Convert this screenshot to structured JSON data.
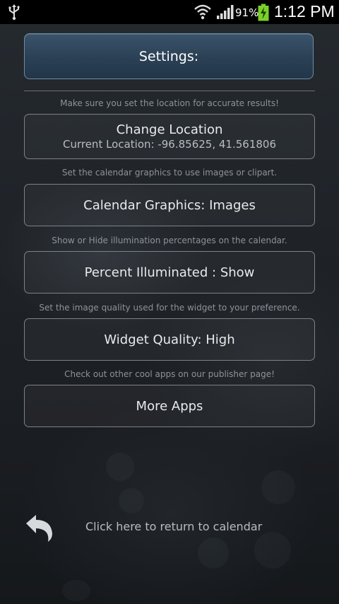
{
  "status_bar": {
    "battery_percent": "91%",
    "time": "1:12 PM",
    "icons": [
      "usb-icon",
      "wifi-icon",
      "signal-icon",
      "battery-charging-icon"
    ]
  },
  "header": {
    "title": "Settings:"
  },
  "sections": [
    {
      "hint": "Make sure you set the location for accurate results!",
      "button_label": "Change Location",
      "button_sub": "Current Location: -96.85625, 41.561806"
    },
    {
      "hint": "Set the calendar graphics to use images or clipart.",
      "button_label": "Calendar Graphics: Images"
    },
    {
      "hint": "Show or Hide illumination percentages on the calendar.",
      "button_label": "Percent Illuminated : Show"
    },
    {
      "hint": "Set the image quality used for the widget to your preference.",
      "button_label": "Widget Quality: High"
    },
    {
      "hint": "Check out other cool apps on our publisher page!",
      "button_label": "More Apps"
    }
  ],
  "footer": {
    "back_label": "Click here to return to calendar",
    "back_icon": "back-arrow-icon"
  },
  "colors": {
    "header_bg": "#2b4054",
    "header_border": "#6f8aa3",
    "button_border": "#7d8287",
    "hint_text": "#8d9399",
    "battery_green": "#7ad02a"
  }
}
